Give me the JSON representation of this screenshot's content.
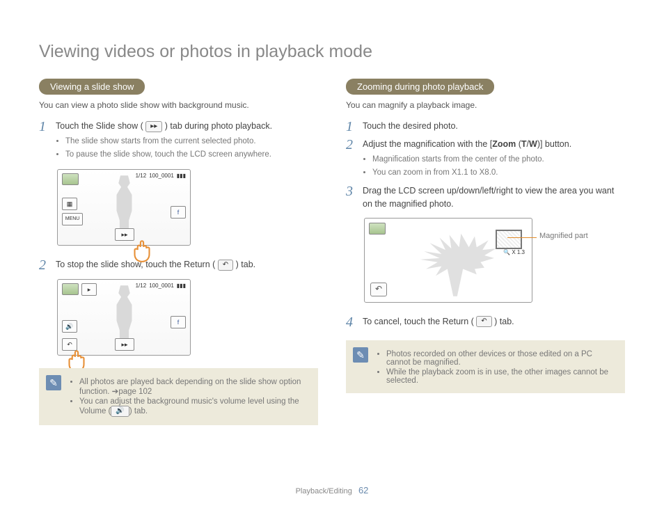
{
  "page_title": "Viewing videos or photos in playback mode",
  "footer": {
    "section": "Playback/Editing",
    "page": "62"
  },
  "left": {
    "heading": "Viewing a slide show",
    "intro": "You can view a photo slide show with background music.",
    "step1": {
      "text_a": "Touch the Slide show (",
      "icon": "▸▸",
      "text_b": ") tab during photo playback.",
      "bullets": [
        "The slide show starts from the current selected photo.",
        "To pause the slide show, touch the LCD screen anywhere."
      ]
    },
    "ss1": {
      "count": "1/12",
      "file": "100_0001",
      "menu": "MENU"
    },
    "step2": {
      "text_a": "To stop the slide show, touch the Return (",
      "icon": "↶",
      "text_b": ") tab."
    },
    "ss2": {
      "count": "1/12",
      "file": "100_0001"
    },
    "note": {
      "b1_a": "All photos are played back depending on the slide show option function. ",
      "b1_b": "page 102",
      "b2_a": "You can adjust the background music's volume level using the Volume (",
      "b2_icon": "🔊",
      "b2_b": ") tab."
    }
  },
  "right": {
    "heading": "Zooming during photo playback",
    "intro": "You can magnify a playback image.",
    "step1": "Touch the desired photo.",
    "step2": {
      "text_a": "Adjust the magnification with the [",
      "bold1": "Zoom",
      "text_b": " (",
      "bold2": "T",
      "text_c": "/",
      "bold3": "W",
      "text_d": ")] button.",
      "bullets": [
        "Magnification starts from the center of the photo.",
        "You can zoom in from X1.1 to X8.0."
      ]
    },
    "step3": "Drag the LCD screen up/down/left/right to view the area you want on the magnified photo.",
    "ss": {
      "zoom": "X 1.3",
      "callout": "Magnified part"
    },
    "step4": {
      "text_a": "To cancel, touch the Return (",
      "icon": "↶",
      "text_b": ") tab."
    },
    "note": {
      "b1": "Photos recorded on other devices or those edited on a PC cannot be magnified.",
      "b2": "While the playback zoom is in use, the other images cannot be selected."
    }
  }
}
